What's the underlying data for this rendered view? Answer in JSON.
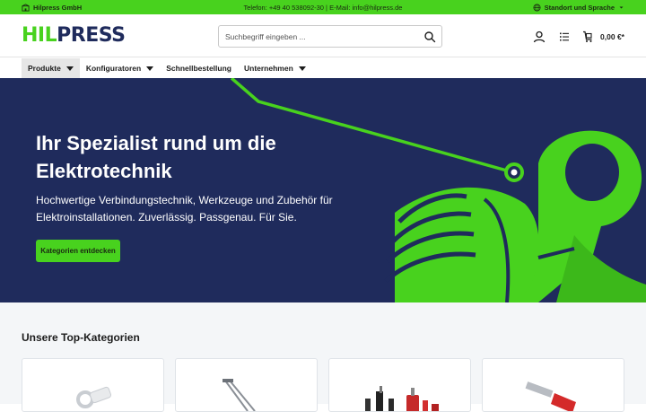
{
  "topbar": {
    "company": "Hilpress GmbH",
    "contact": "Telefon: +49 40 538092-30 | E-Mail: info@hilpress.de",
    "locale": "Standort und Sprache"
  },
  "header": {
    "logo_part1": "HIL",
    "logo_part2": "PRESS",
    "search_placeholder": "Suchbegriff eingeben ...",
    "cart_total": "0,00 €*"
  },
  "nav": {
    "items": [
      {
        "label": "Produkte"
      },
      {
        "label": "Konfiguratoren"
      },
      {
        "label": "Schnellbestellung"
      },
      {
        "label": "Unternehmen"
      }
    ]
  },
  "hero": {
    "title": "Ihr Spezialist rund um die Elektrotechnik",
    "subtitle": "Hochwertige Verbindungstechnik, Werkzeuge und Zubehör für Elektroinstallationen. Zuverlässig. Passgenau. Für Sie.",
    "cta_label": "Kategorien entdecken"
  },
  "categories": {
    "title": "Unsere Top-Kategorien"
  },
  "colors": {
    "brand_green": "#48d21e",
    "brand_navy": "#1f2b5c"
  },
  "icons": {
    "company": "building-icon",
    "locale": "globe-icon",
    "search": "search-icon",
    "account": "user-icon",
    "list": "list-icon",
    "cart": "cart-icon"
  }
}
